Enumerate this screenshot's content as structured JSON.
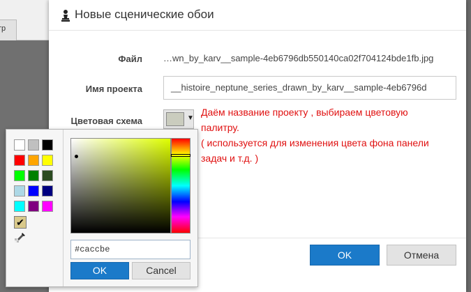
{
  "background": {
    "tab_label": "тр"
  },
  "dialog": {
    "title": "Новые сценические обои",
    "file_label": "Файл",
    "file_value": "…wn_by_karv__sample-4eb6796db550140ca02f704124bde1fb.jpg",
    "project_name_label": "Имя проекта",
    "project_name_value": "__histoire_neptune_series_drawn_by_karv__sample-4eb6796d",
    "color_scheme_label": "Цветовая схема",
    "selected_color": "#caccbe",
    "ok_label": "OK",
    "cancel_label": "Отмена"
  },
  "annotation": {
    "lines": [
      "Даём название проекту , выбираем цветовую",
      "палитру.",
      "( используется для изменения цвета фона панели",
      "задач и т.д. )"
    ],
    "color": "#e01010"
  },
  "color_picker": {
    "palette": [
      "#ffffff",
      "#c0c0c0",
      "#000000",
      "#ff0000",
      "#ffa500",
      "#ffff00",
      "#00ff00",
      "#008000",
      "#2b4a20",
      "#add8e6",
      "#0000ff",
      "#000080",
      "#00ffff",
      "#800080",
      "#ff00ff"
    ],
    "hex_value": "#caccbe",
    "ok_label": "OK",
    "cancel_label": "Cancel"
  }
}
